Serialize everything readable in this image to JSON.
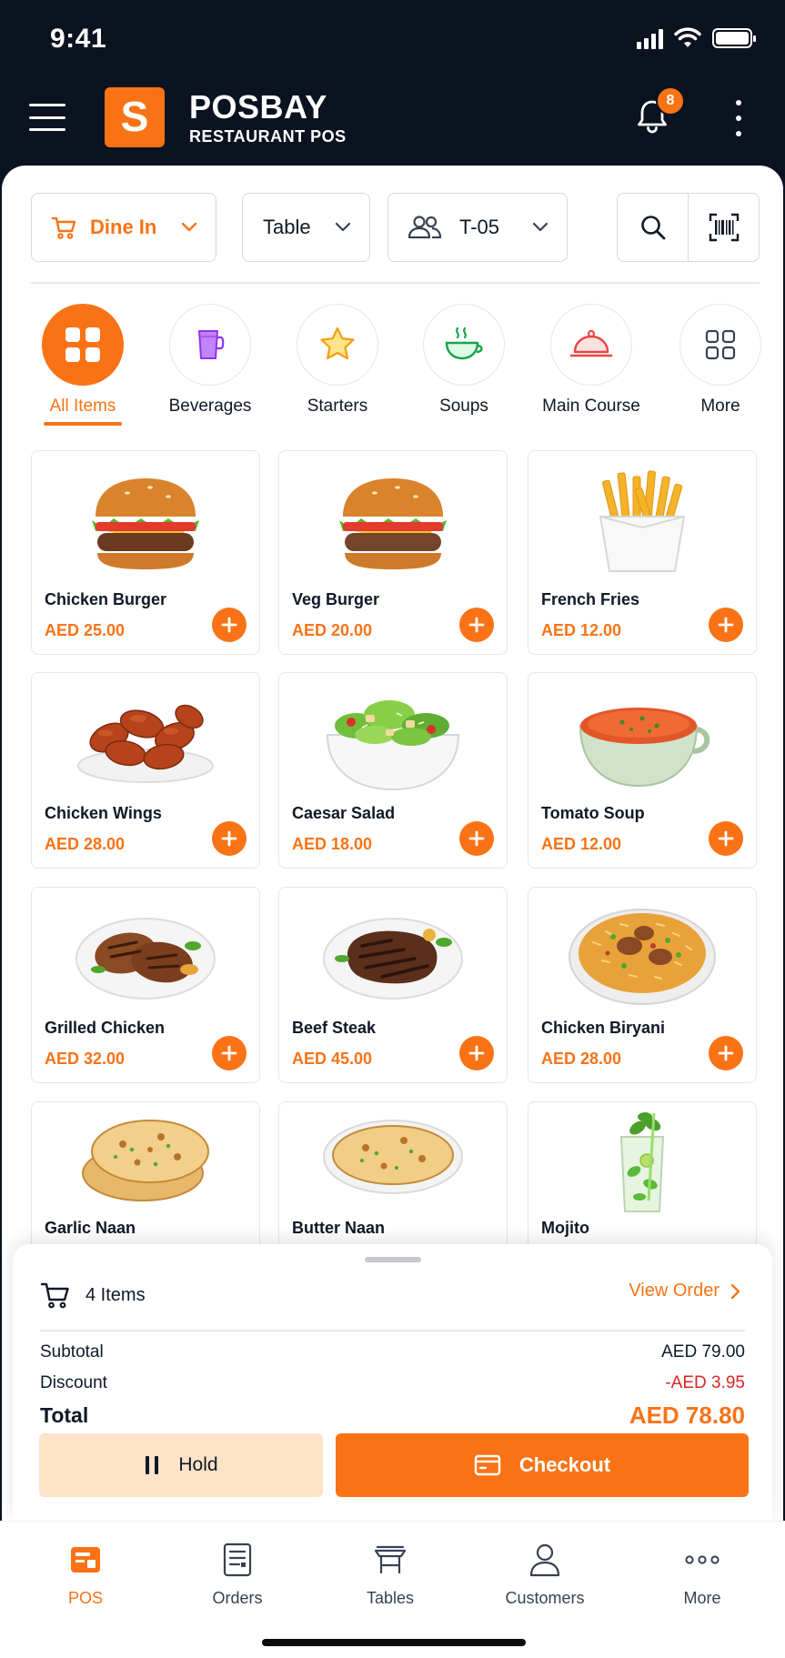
{
  "status_bar": {
    "time": "9:41"
  },
  "header": {
    "brand_name": "POSBAY",
    "brand_subtitle": "RESTAURANT POS",
    "notification_count": "8",
    "logo_letter": "S"
  },
  "filters": {
    "order_type": "Dine In",
    "table_label": "Table",
    "table_number": "T-05"
  },
  "categories": [
    {
      "label": "All Items",
      "icon": "grid-icon",
      "active": true
    },
    {
      "label": "Beverages",
      "icon": "drink-icon"
    },
    {
      "label": "Starters",
      "icon": "star-icon"
    },
    {
      "label": "Soups",
      "icon": "soup-bowl-icon"
    },
    {
      "label": "Main Course",
      "icon": "cloche-icon"
    },
    {
      "label": "More",
      "icon": "apps-icon"
    }
  ],
  "products": [
    {
      "name": "Chicken Burger",
      "price": "AED 25.00"
    },
    {
      "name": "Veg Burger",
      "price": "AED 20.00"
    },
    {
      "name": "French Fries",
      "price": "AED 12.00"
    },
    {
      "name": "Chicken Wings",
      "price": "AED 28.00"
    },
    {
      "name": "Caesar Salad",
      "price": "AED 18.00"
    },
    {
      "name": "Tomato Soup",
      "price": "AED 12.00"
    },
    {
      "name": "Grilled Chicken",
      "price": "AED 32.00"
    },
    {
      "name": "Beef Steak",
      "price": "AED 45.00"
    },
    {
      "name": "Chicken Biryani",
      "price": "AED 28.00"
    },
    {
      "name": "Garlic Naan"
    },
    {
      "name": "Butter Naan"
    },
    {
      "name": "Mojito"
    }
  ],
  "order_summary": {
    "items_count": "4 Items",
    "view_order_label": "View Order",
    "subtotal_label": "Subtotal",
    "subtotal_value": "AED 79.00",
    "discount_label": "Discount",
    "discount_value": "-AED 3.95",
    "total_label": "Total",
    "total_value": "AED 78.80",
    "hold_label": "Hold",
    "checkout_label": "Checkout"
  },
  "bottom_nav": [
    {
      "label": "POS",
      "icon": "pos-icon",
      "active": true
    },
    {
      "label": "Orders",
      "icon": "orders-icon"
    },
    {
      "label": "Tables",
      "icon": "table-icon"
    },
    {
      "label": "Customers",
      "icon": "user-icon"
    },
    {
      "label": "More",
      "icon": "more-dots-icon"
    }
  ],
  "colors": {
    "accent": "#f97316",
    "header_bg": "#0b1220",
    "discount": "#dc2626",
    "hold_bg": "#fde3c8"
  }
}
